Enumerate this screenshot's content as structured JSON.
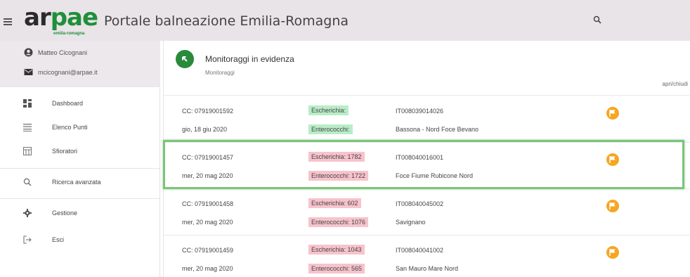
{
  "header": {
    "logo_text_a": "ar",
    "logo_text_b": "pae",
    "logo_sub": "emilia-romagna",
    "title": "Portale balneazione Emilia-Romagna"
  },
  "user": {
    "name": "Matteo Cicognani",
    "email": "mcicognani@arpae.it"
  },
  "sidebar": {
    "items": [
      {
        "label": "Dashboard",
        "icon": "dashboard-icon"
      },
      {
        "label": "Elenco Punti",
        "icon": "list-icon"
      },
      {
        "label": "Sfioratori",
        "icon": "grid-icon"
      },
      {
        "label": "Ricerca avanzata",
        "icon": "search-icon"
      },
      {
        "label": "Gestione",
        "icon": "gear-icon"
      },
      {
        "label": "Esci",
        "icon": "logout-icon"
      }
    ]
  },
  "card": {
    "title": "Monitoraggi in evidenza",
    "subtitle": "Monitoraggi",
    "toggle_label": "apri/chiudi"
  },
  "rows": [
    {
      "cc": "CC: 07919001592",
      "date": "gio, 18 giu 2020",
      "escherichia": "Escherichia:",
      "enterococchi": "Enterococchi:",
      "status": "green",
      "code": "IT008039014026",
      "place": "Bassona - Nord Foce Bevano"
    },
    {
      "cc": "CC: 07919001457",
      "date": "mer, 20 mag 2020",
      "escherichia": "Escherichia: 1782",
      "enterococchi": "Enterococchi: 1722",
      "status": "red",
      "code": "IT008040016001",
      "place": "Foce Fiume Rubicone Nord"
    },
    {
      "cc": "CC: 07919001458",
      "date": "mer, 20 mag 2020",
      "escherichia": "Escherichia: 602",
      "enterococchi": "Enterococchi: 1076",
      "status": "red",
      "code": "IT008040045002",
      "place": "Savignano"
    },
    {
      "cc": "CC: 07919001459",
      "date": "mer, 20 mag 2020",
      "escherichia": "Escherichia: 1043",
      "enterococchi": "Enterococchi: 565",
      "status": "red",
      "code": "IT008040041002",
      "place": "San Mauro Mare Nord"
    }
  ],
  "colors": {
    "brand_green": "#1f8f3a",
    "flag_orange": "#f5a623",
    "ok_badge": "#b9edc7",
    "alert_badge": "#f7c3cc",
    "highlight": "#7ac57a"
  }
}
